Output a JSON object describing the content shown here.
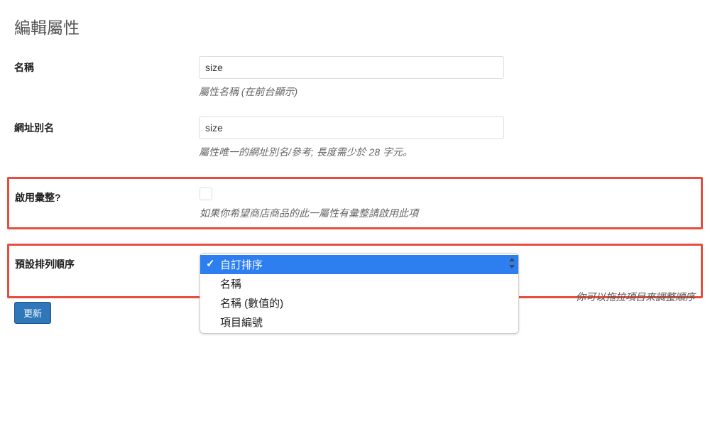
{
  "page_title": "編輯屬性",
  "name": {
    "label": "名稱",
    "value": "size",
    "help": "屬性名稱 (在前台顯示)"
  },
  "slug": {
    "label": "網址別名",
    "value": "size",
    "help": "屬性唯一的網址別名/參考; 長度需少於 28 字元。"
  },
  "archive": {
    "label": "啟用彙整?",
    "value": "",
    "help": "如果你希望商店商品的此一屬性有彙整請啟用此項"
  },
  "orderby": {
    "label": "預設排列順序",
    "options": [
      "自訂排序",
      "名稱",
      "名稱 (數值的)",
      "項目編號"
    ],
    "selected": "自訂排序",
    "hint": "你可以拖拉項目來調整順序"
  },
  "submit_label": "更新"
}
